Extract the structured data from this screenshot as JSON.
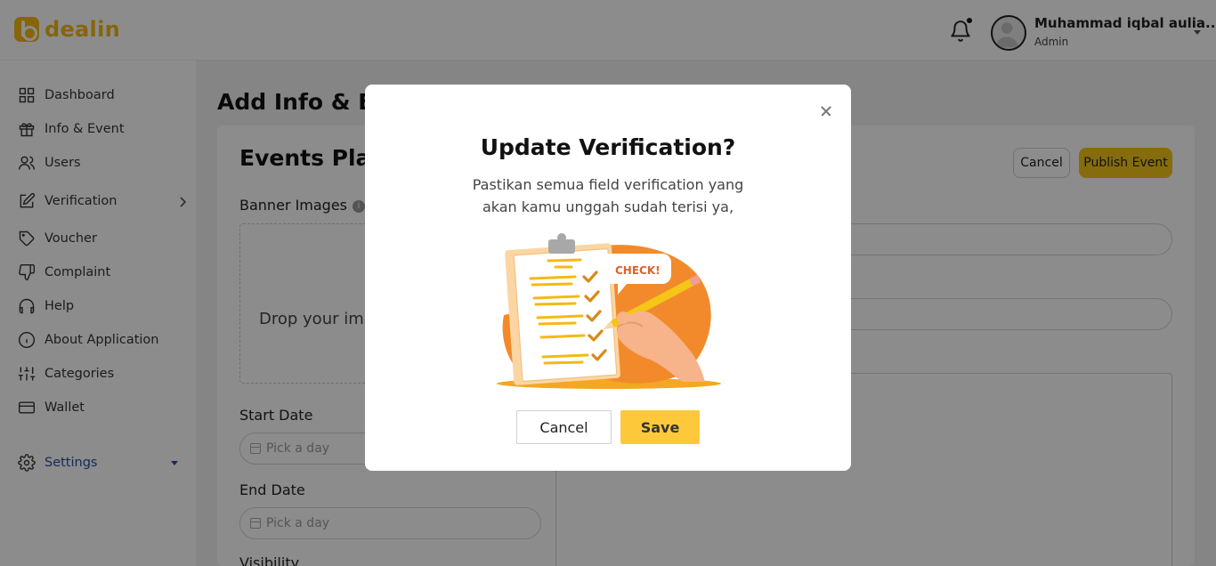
{
  "brand": {
    "name": "dealin",
    "color": "#f5b915"
  },
  "header": {
    "user_name": "Muhammad iqbal aulia...",
    "user_role": "Admin"
  },
  "sidebar": {
    "items": [
      {
        "label": "Dashboard",
        "icon": "grid-icon"
      },
      {
        "label": "Info & Event",
        "icon": "gift-icon"
      },
      {
        "label": "Users",
        "icon": "users-icon"
      },
      {
        "label": "Verification",
        "icon": "edit-icon"
      },
      {
        "label": "Voucher",
        "icon": "tag-icon"
      },
      {
        "label": "Complaint",
        "icon": "thumbs-down-icon"
      },
      {
        "label": "Help",
        "icon": "headphones-icon"
      },
      {
        "label": "About Application",
        "icon": "info-icon"
      },
      {
        "label": "Categories",
        "icon": "sliders-icon"
      },
      {
        "label": "Wallet",
        "icon": "wallet-icon"
      }
    ],
    "settings_label": "Settings",
    "active_color": "#2b4c9b"
  },
  "page": {
    "title": "Add Info & Eve",
    "card_title": "Events Plan",
    "cancel_label": "Cancel",
    "publish_label": "Publish Event",
    "banner_label": "Banner Images",
    "drop_text": "Drop your ima",
    "start_date_label": "Start Date",
    "start_date_placeholder": "Pick a day",
    "end_date_label": "End Date",
    "end_date_placeholder": "Pick a day",
    "visibility_label": "Visibility"
  },
  "modal": {
    "title": "Update Verification?",
    "desc_line1": "Pastikan semua field verification yang",
    "desc_line2": "akan kamu unggah sudah terisi ya,",
    "illustration_text": "CHECK!",
    "cancel_label": "Cancel",
    "save_label": "Save",
    "save_color": "#fdc93a"
  }
}
